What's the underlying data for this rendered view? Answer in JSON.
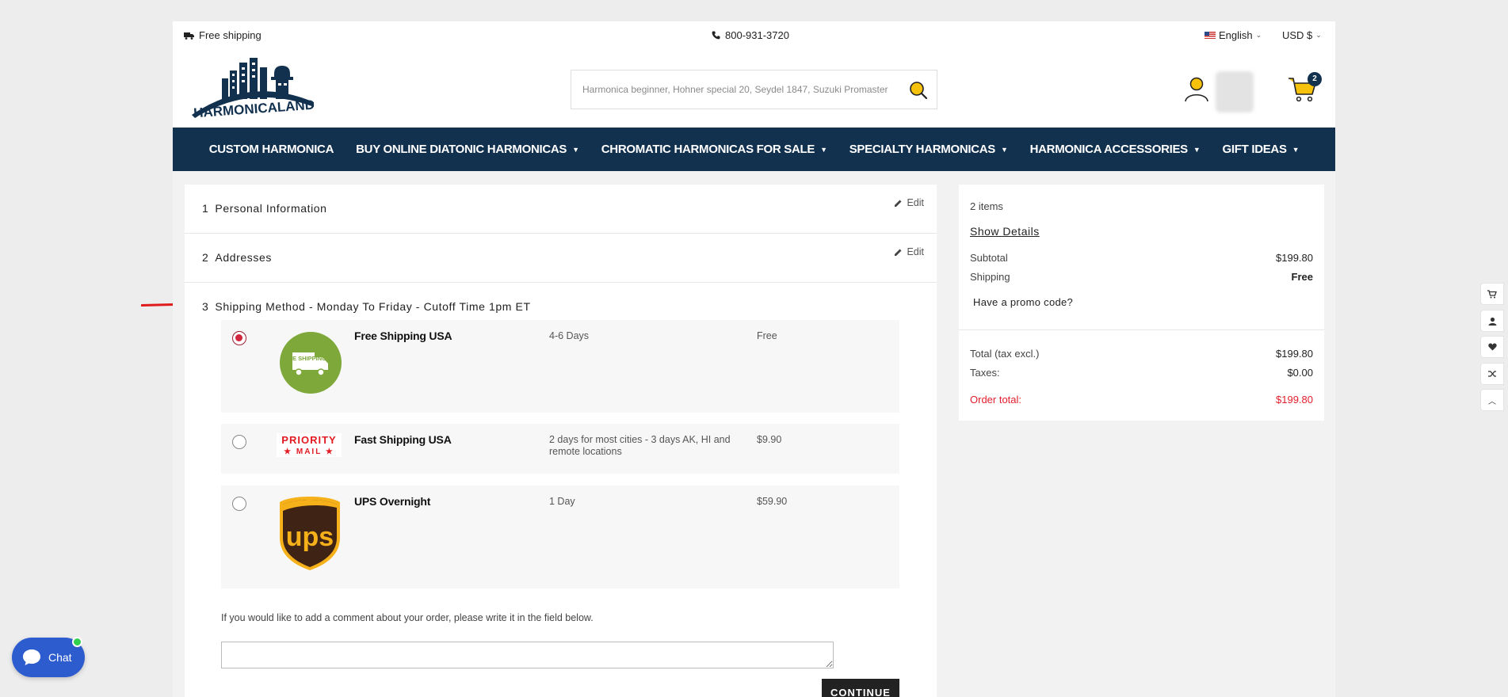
{
  "topbar": {
    "free_shipping": "Free shipping",
    "phone": "800-931-3720",
    "language": "English",
    "currency": "USD $"
  },
  "header": {
    "logo_text": "HARMONICALAND",
    "search_placeholder": "Harmonica beginner, Hohner special 20, Seydel 1847, Suzuki Promaster",
    "cart_count": "2"
  },
  "nav": {
    "items": [
      {
        "label": "CUSTOM HARMONICA",
        "dropdown": false
      },
      {
        "label": "BUY ONLINE DIATONIC HARMONICAS",
        "dropdown": true
      },
      {
        "label": "CHROMATIC HARMONICAS FOR SALE",
        "dropdown": true
      },
      {
        "label": "SPECIALTY HARMONICAS",
        "dropdown": true
      },
      {
        "label": "HARMONICA ACCESSORIES",
        "dropdown": true
      },
      {
        "label": "GIFT IDEAS",
        "dropdown": true
      }
    ]
  },
  "checkout": {
    "steps": [
      {
        "num": "1",
        "title": "Personal Information",
        "edit": "Edit"
      },
      {
        "num": "2",
        "title": "Addresses",
        "edit": "Edit"
      }
    ],
    "shipping_step": {
      "num": "3",
      "title": "Shipping Method - Monday To Friday - Cutoff Time 1pm ET"
    },
    "options": [
      {
        "carrier": "Free Shipping USA",
        "delay": "4-6 Days",
        "price": "Free",
        "selected": true,
        "logo": "free-shipping-truck",
        "logo_text": "FREE SHIPPING"
      },
      {
        "carrier": "Fast Shipping USA",
        "delay": "2 days for most cities - 3 days AK, HI and remote locations",
        "price": "$9.90",
        "selected": false,
        "logo": "priority-mail",
        "logo_text": [
          "PRIORITY",
          "★ MAIL ★"
        ]
      },
      {
        "carrier": "UPS Overnight",
        "delay": "1 Day",
        "price": "$59.90",
        "selected": false,
        "logo": "ups-shield",
        "logo_text": "ups"
      }
    ],
    "comment_label": "If you would like to add a comment about your order, please write it in the field below.",
    "comment_value": "",
    "continue_label": "CONTINUE"
  },
  "summary": {
    "items_count": "2 items",
    "show_details": "Show Details",
    "subtotal_label": "Subtotal",
    "subtotal_value": "$199.80",
    "shipping_label": "Shipping",
    "shipping_value": "Free",
    "promo_label": "Have a promo code?",
    "total_excl_label": "Total (tax excl.)",
    "total_excl_value": "$199.80",
    "taxes_label": "Taxes:",
    "taxes_value": "$0.00",
    "order_total_label": "Order total:",
    "order_total_value": "$199.80"
  },
  "side_tools": [
    "cart-icon",
    "user-icon",
    "heart-icon",
    "shuffle-icon",
    "chevron-up-icon"
  ],
  "chat": {
    "label": "Chat"
  },
  "colors": {
    "nav_bg": "#12314f",
    "order_total": "#e11d2a",
    "radio_selected": "#d2263f",
    "chat_bg": "#2d5ccf",
    "online_dot": "#31d04f",
    "free_shipping_green": "#7ea83a",
    "ups_brown": "#3f2416",
    "ups_gold": "#f5b01a",
    "priority_red": "#e21a22"
  }
}
